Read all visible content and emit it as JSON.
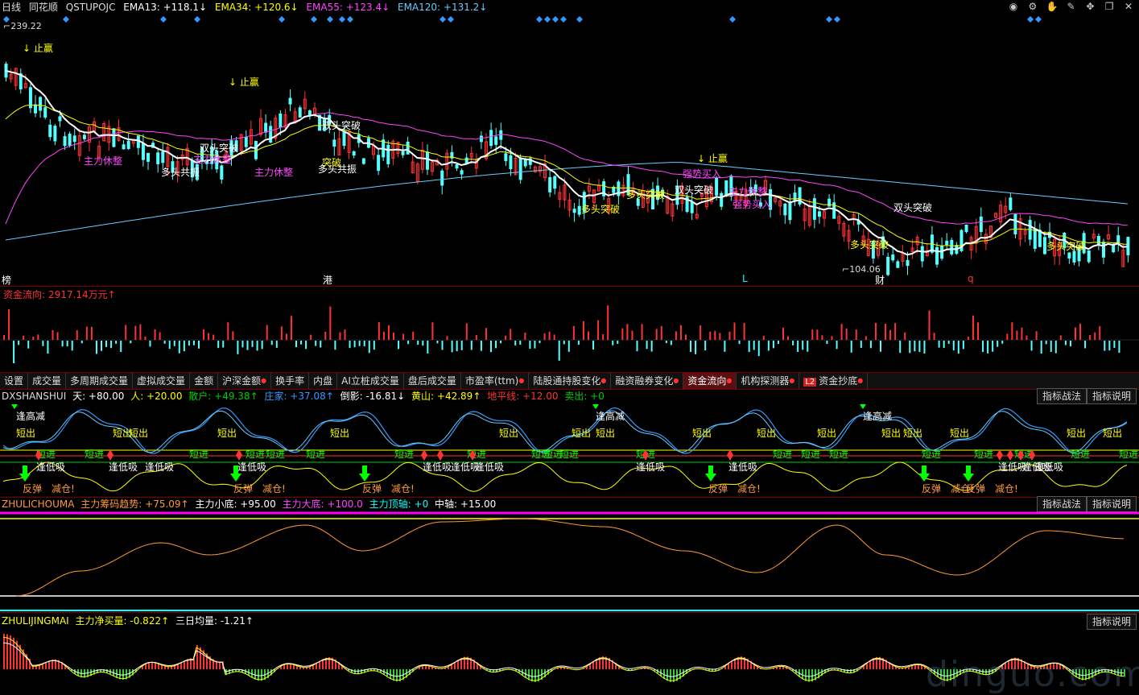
{
  "top": {
    "period": "日线",
    "source": "同花顺",
    "indicator": "QSTUPOJC",
    "ema13": "EMA13: +118.1↓",
    "ema34": "EMA34: +120.6↓",
    "ema55": "EMA55: +123.4↓",
    "ema120": "EMA120: +131.2↓",
    "icons": [
      "eye-icon",
      "settings-icon",
      "hand-icon",
      "tool-icon",
      "move-icon",
      "window-icon",
      "close-icon"
    ]
  },
  "main": {
    "high_label": "239.22",
    "low_label": "104.06",
    "annotations": [
      {
        "text": "止赢",
        "color": "#ffff00"
      },
      {
        "text": "止赢",
        "color": "#ffff00"
      },
      {
        "text": "止赢",
        "color": "#ffff00"
      },
      {
        "text": "双头突破",
        "color": "#ffffff"
      },
      {
        "text": "双头突破",
        "color": "#ffffff"
      },
      {
        "text": "双头突破",
        "color": "#ffffff"
      },
      {
        "text": "双头突破",
        "color": "#ffffff"
      },
      {
        "text": "多头共振",
        "color": "#ffffff"
      },
      {
        "text": "多头共振",
        "color": "#ffffff"
      },
      {
        "text": "多头突破",
        "color": "#ffff00"
      },
      {
        "text": "多头突破",
        "color": "#ffff00"
      },
      {
        "text": "多头突破",
        "color": "#ffff00"
      },
      {
        "text": "多头突破",
        "color": "#ffff00"
      },
      {
        "text": "主力休整",
        "color": "#ff44ff"
      },
      {
        "text": "主力休整",
        "color": "#ff44ff"
      },
      {
        "text": "主力休整",
        "color": "#ff44ff"
      },
      {
        "text": "主力休整",
        "color": "#ff44ff"
      },
      {
        "text": "强势买入",
        "color": "#ff44ff"
      },
      {
        "text": "强势买入",
        "color": "#ff44ff"
      },
      {
        "text": "突破",
        "color": "#ffff00"
      }
    ],
    "bottom_marks": [
      {
        "text": "榜",
        "color": "#ffffff"
      },
      {
        "text": "港",
        "color": "#ffffff"
      },
      {
        "text": "L",
        "color": "#00ffff"
      },
      {
        "text": "财",
        "color": "#ffffff"
      },
      {
        "text": "q",
        "color": "#ff3333"
      }
    ]
  },
  "flow": {
    "label": "资金流向:",
    "value": "2917.14万元↑"
  },
  "tabs": [
    {
      "label": "设置",
      "dot": false,
      "active": false
    },
    {
      "label": "成交量",
      "dot": false,
      "active": false
    },
    {
      "label": "多周期成交量",
      "dot": false,
      "active": false
    },
    {
      "label": "虚拟成交量",
      "dot": false,
      "active": false
    },
    {
      "label": "金额",
      "dot": false,
      "active": false
    },
    {
      "label": "沪深金额",
      "dot": true,
      "active": false
    },
    {
      "label": "换手率",
      "dot": false,
      "active": false
    },
    {
      "label": "内盘",
      "dot": false,
      "active": false
    },
    {
      "label": "AI立桩成交量",
      "dot": false,
      "active": false
    },
    {
      "label": "盘后成交量",
      "dot": false,
      "active": false
    },
    {
      "label": "市盈率(ttm)",
      "dot": true,
      "active": false
    },
    {
      "label": "陆股通持股变化",
      "dot": true,
      "active": false
    },
    {
      "label": "融资融券变化",
      "dot": true,
      "active": false
    },
    {
      "label": "资金流向",
      "dot": true,
      "active": true
    },
    {
      "label": "机构探测器",
      "dot": true,
      "active": false
    },
    {
      "label": "资金抄底",
      "dot": true,
      "active": false,
      "badge": "L2"
    }
  ],
  "panel1": {
    "name": "DXSHANSHUI",
    "items": [
      {
        "text": "天: +80.00",
        "color": "#ffffff"
      },
      {
        "text": "人: +20.00",
        "color": "#ffff00"
      },
      {
        "text": "散户: +49.38↑",
        "color": "#00cc00"
      },
      {
        "text": "庄家: +37.08↑",
        "color": "#3399ff"
      },
      {
        "text": "倒影: -16.81↓",
        "color": "#ffffff"
      },
      {
        "text": "黄山: +42.89↑",
        "color": "#ffff00"
      },
      {
        "text": "地平线: +12.00",
        "color": "#ff3333"
      },
      {
        "text": "卖出: +0",
        "color": "#00cc00"
      }
    ],
    "btn1": "指标战法",
    "btn2": "指标说明",
    "signals": {
      "short_out": "短出",
      "short_in": "短进",
      "meet_high": "逢高减",
      "meet_low": "逢低吸",
      "rebound": "反弹",
      "reduce": "减仓!"
    }
  },
  "panel2": {
    "name": "ZHULICHOUMA",
    "items": [
      {
        "text": "主力筹码趋势: +75.09↑",
        "color": "#ff9933"
      },
      {
        "text": "主力小底: +95.00",
        "color": "#ffffff"
      },
      {
        "text": "主力大底: +100.0",
        "color": "#ff44ff"
      },
      {
        "text": "主力顶轴: +0",
        "color": "#00ffff"
      },
      {
        "text": "中轴: +15.00",
        "color": "#ffffff"
      }
    ],
    "btn1": "指标战法",
    "btn2": "指标说明"
  },
  "panel3": {
    "name": "ZHULIJINGMAI",
    "items": [
      {
        "text": "主力净买量: -0.822↑",
        "color": "#ffff00"
      },
      {
        "text": "三日均量: -1.21↑",
        "color": "#ffffff"
      }
    ],
    "btn2": "指标说明"
  },
  "watermark": "dinguo.com",
  "colors": {
    "bg": "#000000",
    "up": "#ff3333",
    "down": "#54ffff",
    "ema13": "#ffffff",
    "ema34": "#ffff00",
    "ema55": "#ff44ff",
    "ema120": "#66ccff"
  }
}
